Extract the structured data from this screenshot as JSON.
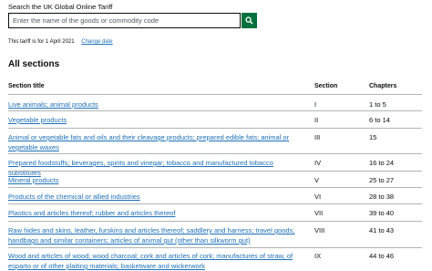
{
  "search": {
    "label": "Search the UK Global Online Tariff",
    "placeholder": "Enter the name of the goods or commodity code"
  },
  "tariff_note": {
    "text": "This tariff is for 1 April 2021",
    "change_link": "Change date"
  },
  "sections": {
    "heading": "All sections",
    "columns": [
      "Section title",
      "Section",
      "Chapters"
    ],
    "rows": [
      {
        "title": "Live animals; animal products",
        "section": "I",
        "chapters": "1 to 5"
      },
      {
        "title": "Vegetable products",
        "section": "II",
        "chapters": "6 to 14"
      },
      {
        "title": "Animal or vegetable fats and oils and their cleavage products; prepared edible fats; animal or vegetable waxes",
        "section": "III",
        "chapters": "15"
      },
      {
        "title": "Prepared foodstuffs; beverages, spirits and vinegar; tobacco and manufactured tobacco substitutes",
        "section": "IV",
        "chapters": "16 to 24"
      },
      {
        "title": "Mineral products",
        "section": "V",
        "chapters": "25 to 27"
      },
      {
        "title": "Products of the chemical or allied industries",
        "section": "VI",
        "chapters": "28 to 38"
      },
      {
        "title": "Plastics and articles thereof; rubber and articles thereof",
        "section": "VII",
        "chapters": "39 to 40"
      },
      {
        "title": "Raw hides and skins, leather, furskins and articles thereof; saddlery and harness; travel goods, handbags and similar containers; articles of animal gut (other than silkworm gut)",
        "section": "VIII",
        "chapters": "41 to 43"
      },
      {
        "title": "Wood and articles of wood; wood charcoal; cork and articles of cork; manufactures of straw, of esparto or of other plaiting materials; basketware and wickerwork",
        "section": "IX",
        "chapters": "44 to 46"
      }
    ]
  },
  "colors": {
    "link": "#1d70b8",
    "search_button": "#00703c",
    "text": "#0b0c0c"
  }
}
